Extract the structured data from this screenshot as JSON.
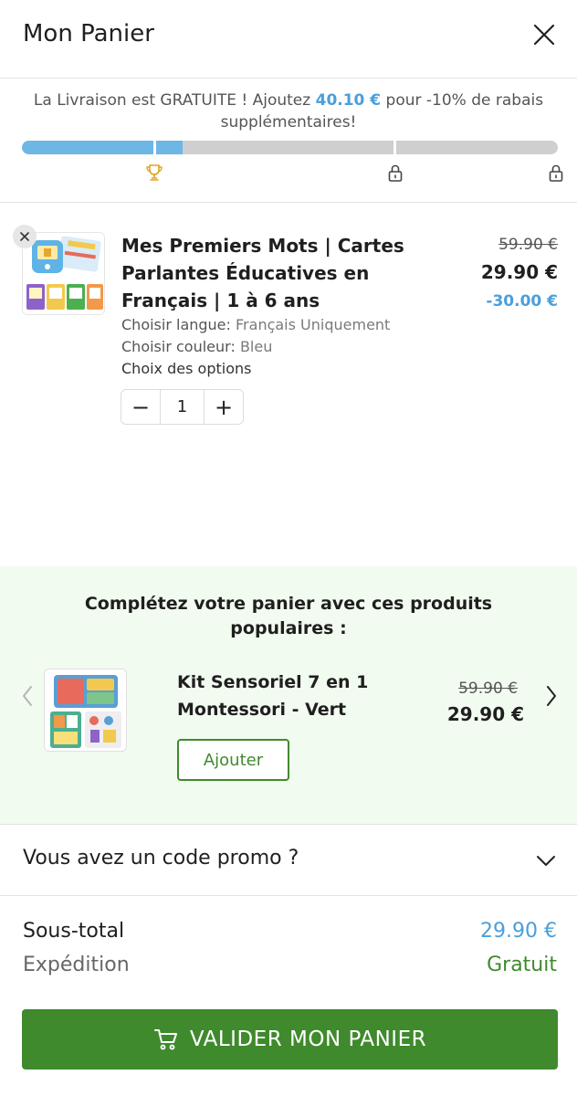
{
  "header": {
    "title": "Mon Panier"
  },
  "shipping": {
    "message_before": "La Livraison est GRATUITE ! Ajoutez ",
    "amount": "40.10 €",
    "message_after": " pour -10% de rabais supplémentaires!",
    "progress_percent": 30
  },
  "cart_item": {
    "name": "Mes Premiers Mots | Cartes Parlantes Éducatives en Français | 1 à 6 ans",
    "old_price": "59.90 €",
    "price": "29.90 €",
    "discount": "-30.00 €",
    "options": [
      {
        "label": "Choisir langue:",
        "value": "Français Uniquement"
      },
      {
        "label": "Choisir couleur:",
        "value": "Bleu"
      }
    ],
    "options_link": "Choix des options",
    "quantity": "1",
    "minus": "−",
    "plus": "+"
  },
  "upsell": {
    "title": "Complétez votre panier avec ces produits populaires :",
    "product_name": "Kit Sensoriel 7 en 1 Montessori - Vert",
    "old_price": "59.90 €",
    "price": "29.90 €",
    "add_label": "Ajouter"
  },
  "promo": {
    "label": "Vous avez un code promo ?"
  },
  "summary": {
    "subtotal_label": "Sous-total",
    "subtotal_value": "29.90 €",
    "shipping_label": "Expédition",
    "shipping_value": "Gratuit"
  },
  "checkout": {
    "label": "VALIDER MON PANIER"
  },
  "icons": {
    "close": "close-icon",
    "trophy": "trophy-icon",
    "lock": "lock-icon",
    "remove": "remove-icon",
    "chevron_left": "chevron-left-icon",
    "chevron_right": "chevron-right-icon",
    "chevron_down": "chevron-down-icon",
    "cart": "cart-icon"
  },
  "colors": {
    "accent_blue": "#4a9fdb",
    "progress_blue": "#6db7e6",
    "trophy_gold": "#e0a322",
    "green": "#3f8a2d",
    "upsell_bg": "#f2fbf0"
  }
}
